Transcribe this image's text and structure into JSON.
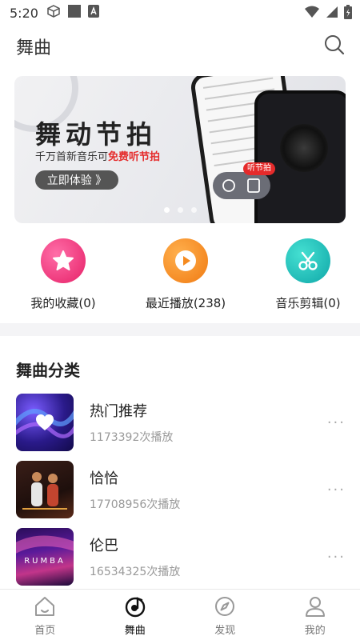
{
  "status_bar": {
    "time": "5:20"
  },
  "header": {
    "title": "舞曲"
  },
  "banner": {
    "title": "舞动节拍",
    "subtitle_prefix": "千万首新音乐可",
    "subtitle_highlight": "免费听节拍",
    "button_label": "立即体验 》",
    "bubble_tag": "听节拍",
    "active_slide": 1,
    "slide_count": 3
  },
  "quick_actions": [
    {
      "label": "我的收藏(0)",
      "icon": "star-icon",
      "color": "#f0397a"
    },
    {
      "label": "最近播放(238)",
      "icon": "play-icon",
      "color": "#f58a1f"
    },
    {
      "label": "音乐剪辑(0)",
      "icon": "scissors-icon",
      "color": "#17b9b5"
    }
  ],
  "section": {
    "title": "舞曲分类"
  },
  "categories": [
    {
      "name": "热门推荐",
      "plays": "1173392次播放"
    },
    {
      "name": "恰恰",
      "plays": "17708956次播放"
    },
    {
      "name": "伦巴",
      "plays": "16534325次播放"
    }
  ],
  "rumba_thumb_text": "RUMBA",
  "bottom_nav": [
    {
      "label": "首页",
      "icon": "home-icon",
      "active": false
    },
    {
      "label": "舞曲",
      "icon": "music-disc-icon",
      "active": true
    },
    {
      "label": "发现",
      "icon": "compass-icon",
      "active": false
    },
    {
      "label": "我的",
      "icon": "profile-icon",
      "active": false
    }
  ]
}
